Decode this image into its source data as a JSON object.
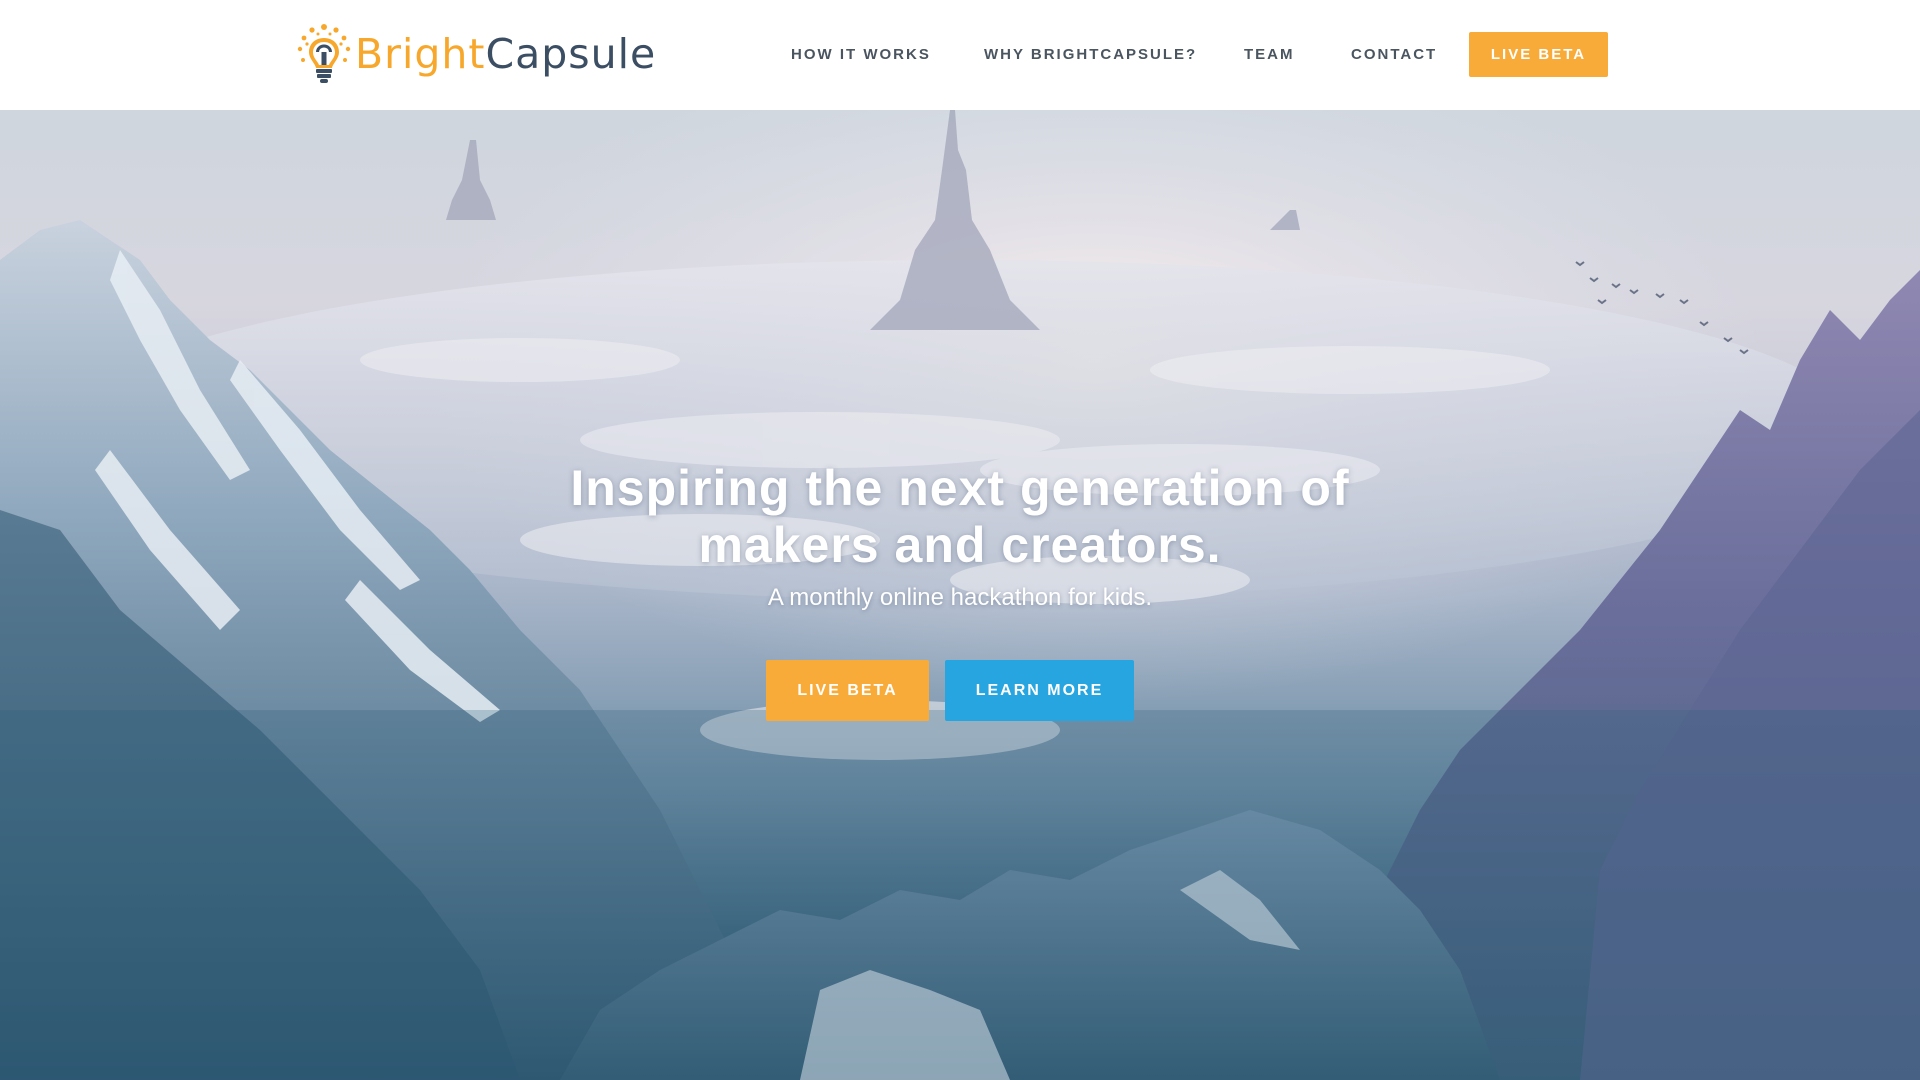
{
  "brand": {
    "name_part1": "Bright",
    "name_part2": "Capsule",
    "colors": {
      "accent_orange": "#f9ab3a",
      "accent_blue": "#26a5e0",
      "text_dark": "#3b4e63"
    }
  },
  "nav": {
    "items": [
      {
        "label": "HOW IT WORKS"
      },
      {
        "label": "WHY BRIGHTCAPSULE?"
      },
      {
        "label": "TEAM"
      },
      {
        "label": "CONTACT"
      }
    ],
    "cta_label": "LIVE BETA"
  },
  "hero": {
    "title_line1": "Inspiring the next generation of",
    "title_line2": "makers and creators.",
    "subtitle": "A monthly online hackathon for kids.",
    "primary_button": "LIVE BETA",
    "secondary_button": "LEARN MORE"
  }
}
